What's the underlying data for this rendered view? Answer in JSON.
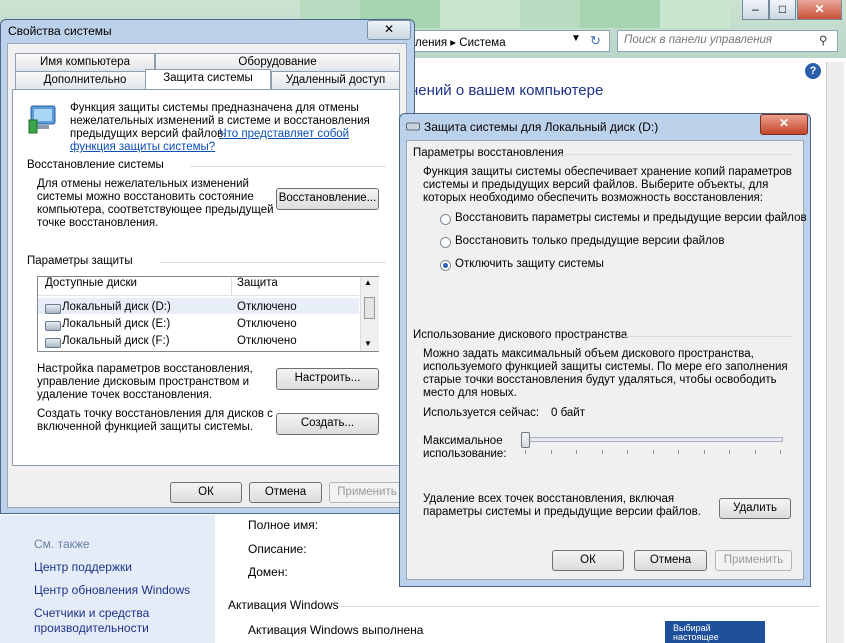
{
  "background": {
    "breadcrumb": "ления ▸ Система",
    "search_placeholder": "Поиск в панели управления",
    "page_heading": "нений о вашем компьютере",
    "see_also": "См. также",
    "links": [
      "Центр поддержки",
      "Центр обновления Windows",
      "Счетчики и средства производительности"
    ],
    "fields": [
      "Полное имя:",
      "Описание:",
      "Домен:"
    ],
    "activation_header": "Активация Windows",
    "activation_status": "Активация Windows выполнена",
    "badge": "Выбирай настоящее"
  },
  "dialog1": {
    "title": "Свойства системы",
    "close_glyph": "✕",
    "tabs_row1": [
      "Имя компьютера",
      "Оборудование"
    ],
    "tabs_row2": [
      "Дополнительно",
      "Защита системы",
      "Удаленный доступ"
    ],
    "intro": [
      "Функция защиты системы предназначена для отмены",
      "нежелательных изменений в системе и восстановления",
      "предыдущих версий файлов."
    ],
    "intro_link": [
      "Что представляет собой",
      "функция защиты системы?"
    ],
    "restore_group": "Восстановление системы",
    "restore_text": [
      "Для отмены нежелательных изменений",
      "системы можно восстановить состояние",
      "компьютера, соответствующее предыдущей",
      "точке восстановления."
    ],
    "restore_button": "Восстановление...",
    "protection_group": "Параметры защиты",
    "columns": [
      "Доступные диски",
      "Защита"
    ],
    "drives": [
      {
        "name": "Локальный диск (D:)",
        "status": "Отключено"
      },
      {
        "name": "Локальный диск (E:)",
        "status": "Отключено"
      },
      {
        "name": "Локальный диск (F:)",
        "status": "Отключено"
      }
    ],
    "configure_text": [
      "Настройка параметров восстановления,",
      "управление дисковым пространством и",
      "удаление точек восстановления."
    ],
    "configure_button": "Настроить...",
    "create_text": [
      "Создать точку восстановления для дисков с",
      "включенной функцией защиты системы."
    ],
    "create_button": "Создать...",
    "ok": "ОК",
    "cancel": "Отмена",
    "apply": "Применить"
  },
  "dialog2": {
    "title": "Защита системы для Локальный диск (D:)",
    "close_glyph": "✕",
    "restore_group": "Параметры восстановления",
    "restore_text": [
      "Функция защиты системы обеспечивает хранение копий параметров",
      "системы и предыдущих версий файлов. Выберите объекты, для",
      "которых необходимо обеспечить возможность восстановления:"
    ],
    "options": [
      "Восстановить параметры системы и предыдущие версии файлов",
      "Восстановить только предыдущие версии файлов",
      "Отключить защиту системы"
    ],
    "selected_option": 2,
    "disk_group": "Использование дискового пространства",
    "disk_text": [
      "Можно задать максимальный объем дискового пространства,",
      "используемого функцией защиты системы. По мере его заполнения",
      "старые точки восстановления будут удаляться, чтобы освободить",
      "место для новых."
    ],
    "used_label": "Используется сейчас:",
    "used_value": "0 байт",
    "max_label": [
      "Максимальное",
      "использование:"
    ],
    "max_usage_fraction": 0,
    "delete_text": [
      "Удаление всех точек восстановления, включая",
      "параметры системы и предыдущие версии файлов."
    ],
    "delete_button": "Удалить",
    "ok": "ОК",
    "cancel": "Отмена",
    "apply": "Применить"
  }
}
